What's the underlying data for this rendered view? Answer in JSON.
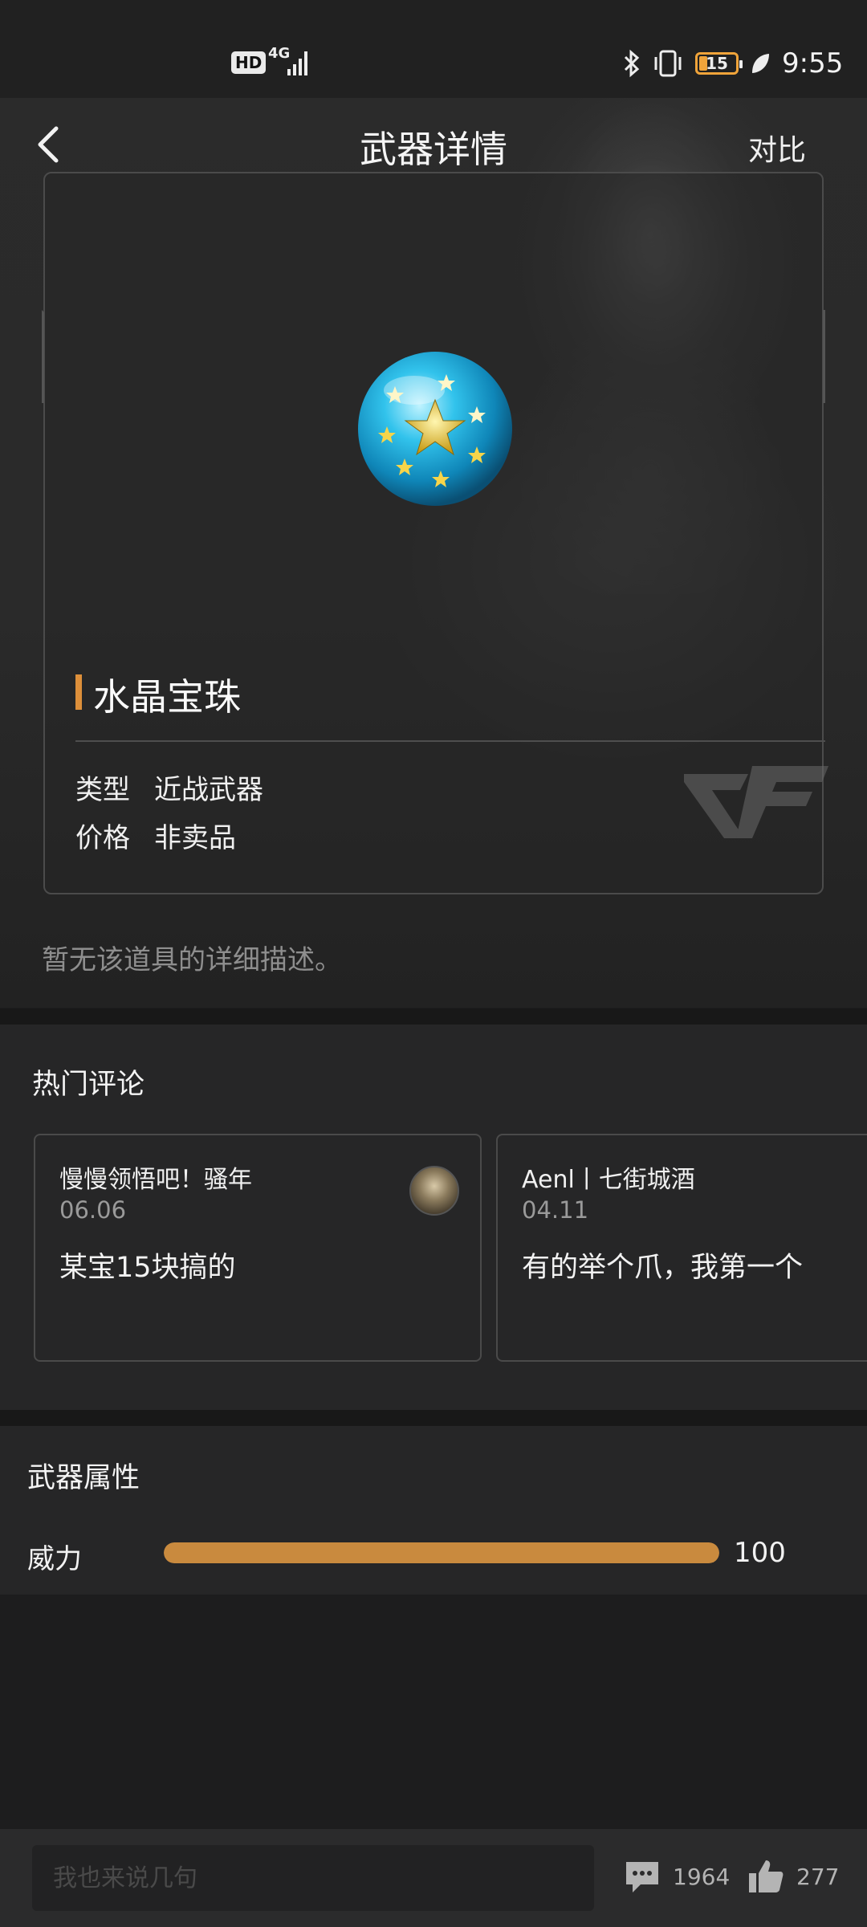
{
  "status_bar": {
    "hd": "HD",
    "network": "4G",
    "battery": "15",
    "time": "9:55"
  },
  "nav": {
    "title": "武器详情",
    "compare_label": "对比"
  },
  "item": {
    "name": "水晶宝珠",
    "props": [
      {
        "key": "类型",
        "value": "近战武器"
      },
      {
        "key": "价格",
        "value": "非卖品"
      }
    ],
    "description": "暂无该道具的详细描述。"
  },
  "comments_section": {
    "title": "热门评论",
    "comments": [
      {
        "user": "慢慢领悟吧！骚年",
        "date": "06.06",
        "text": "某宝15块搞的"
      },
      {
        "user": "Aenl丨七街城酒",
        "date": "04.11",
        "text": "有的举个爪，我第一个"
      }
    ]
  },
  "attributes_section": {
    "title": "武器属性",
    "power_label": "威力",
    "power_value": "100",
    "power_fraction": 1.0
  },
  "bottom_bar": {
    "input_placeholder": "我也来说几句",
    "comment_count": "1964",
    "like_count": "277"
  },
  "colors": {
    "accent": "#dd8f3a",
    "bar_fill": "#c98a3e",
    "background": "#1d1d1e"
  }
}
